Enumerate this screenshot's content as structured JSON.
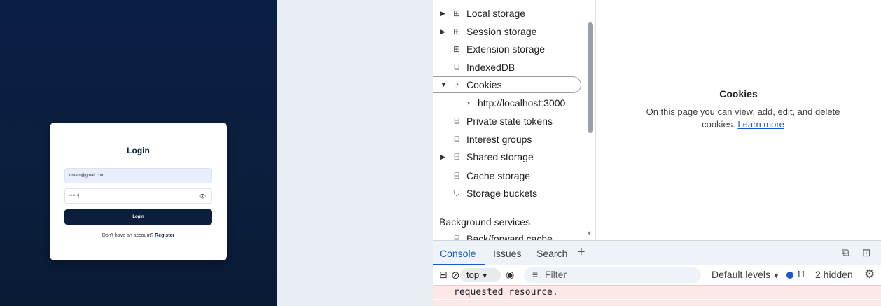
{
  "login": {
    "title": "Login",
    "email_value": "omam@gmail.com",
    "password_value": "••••••|",
    "button_label": "Login",
    "register_prompt": "Don't have an account?",
    "register_link": "Register"
  },
  "devtools": {
    "tree": [
      {
        "label": "Local storage",
        "icon": "table-icon",
        "expandable": true
      },
      {
        "label": "Session storage",
        "icon": "table-icon",
        "expandable": true
      },
      {
        "label": "Extension storage",
        "icon": "table-icon",
        "expandable": false
      },
      {
        "label": "IndexedDB",
        "icon": "database-icon",
        "expandable": false
      },
      {
        "label": "Cookies",
        "icon": "cookie-icon",
        "expandable": true,
        "expanded": true,
        "selected": true
      },
      {
        "label": "http://localhost:3000",
        "icon": "cookie-icon",
        "expandable": false
      },
      {
        "label": "Private state tokens",
        "icon": "database-icon",
        "expandable": false
      },
      {
        "label": "Interest groups",
        "icon": "database-icon",
        "expandable": false
      },
      {
        "label": "Shared storage",
        "icon": "database-icon",
        "expandable": true
      },
      {
        "label": "Cache storage",
        "icon": "database-icon",
        "expandable": false
      },
      {
        "label": "Storage buckets",
        "icon": "bucket-icon",
        "expandable": false
      }
    ],
    "section_background": "Background services",
    "section_partial": "Back/forward cache",
    "info": {
      "title": "Cookies",
      "description": "On this page you can view, add, edit, and delete cookies.",
      "link": "Learn more"
    },
    "drawer_tabs": [
      "Console",
      "Issues",
      "Search"
    ],
    "console": {
      "context": "top",
      "filter_placeholder": "Filter",
      "levels": "Default levels",
      "issues_count": "11",
      "hidden": "2 hidden",
      "message": "requested resource."
    },
    "accent_color": "#1a57c9"
  }
}
